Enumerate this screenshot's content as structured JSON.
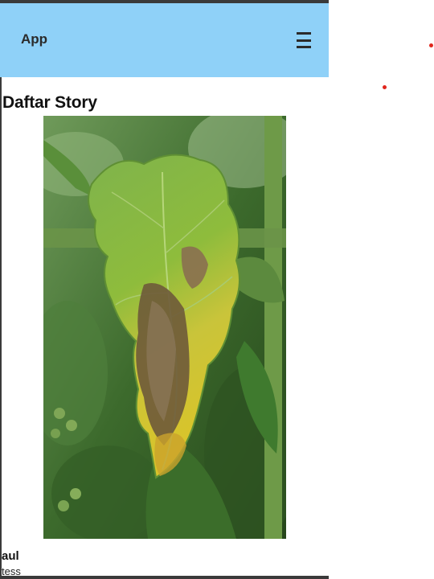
{
  "app_bar": {
    "title": "App",
    "menu_icon": "hamburger-menu-icon",
    "background": "#8fd1f8"
  },
  "page": {
    "heading": "Daftar Story"
  },
  "stories": [
    {
      "name": "aul",
      "description": "tess",
      "image_alt": "Tomato leaf with yellowing and brown blight lesions"
    }
  ],
  "colors": {
    "accent_dot": "#e0261d"
  }
}
